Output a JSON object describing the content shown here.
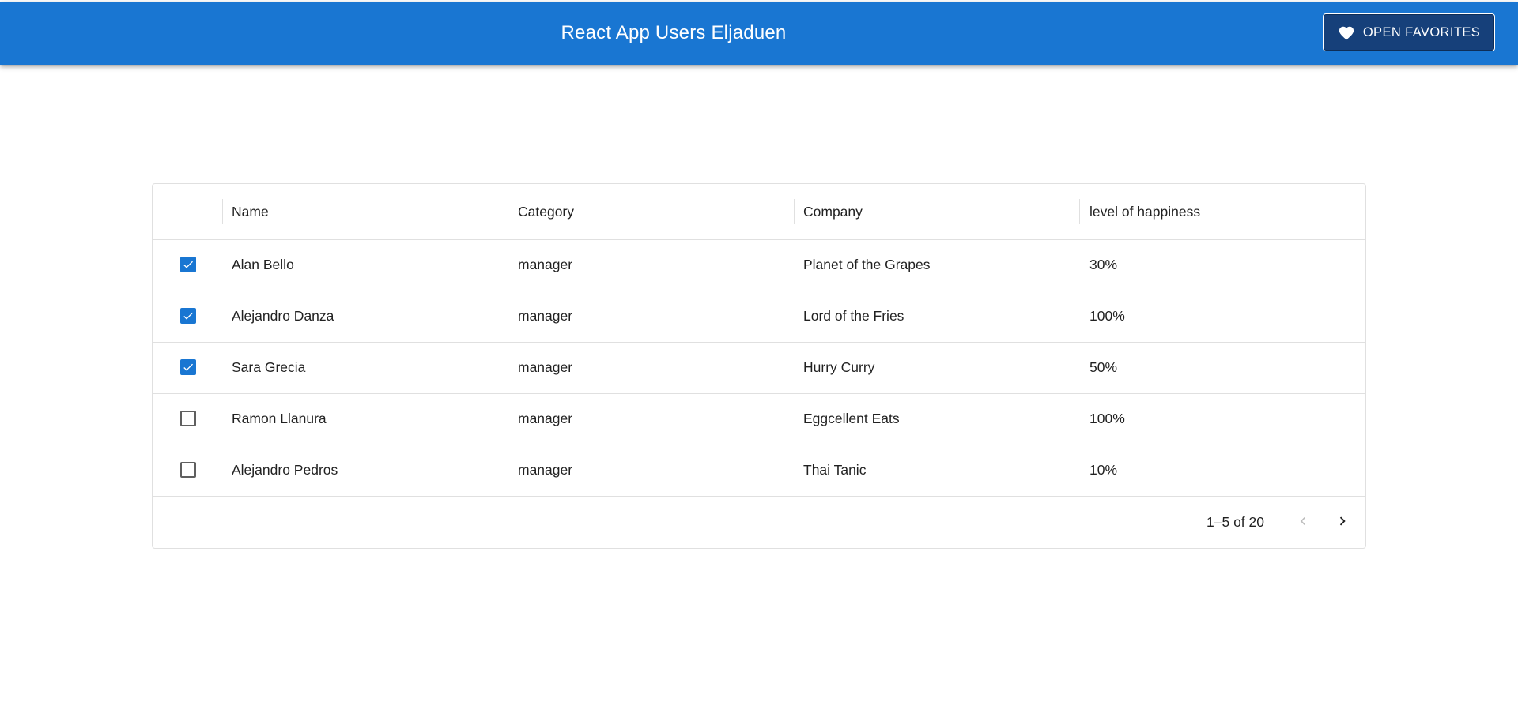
{
  "appbar": {
    "title": "React App Users Eljaduen",
    "favorites_button_label": "OPEN FAVORITES",
    "favorites_icon": "heart-icon",
    "background_color": "#1976d2"
  },
  "grid": {
    "columns": [
      "Name",
      "Category",
      "Company",
      "level of happiness"
    ],
    "rows": [
      {
        "checked": true,
        "name": "Alan Bello",
        "category": "manager",
        "company": "Planet of the Grapes",
        "happiness": "30%"
      },
      {
        "checked": true,
        "name": "Alejandro Danza",
        "category": "manager",
        "company": "Lord of the Fries",
        "happiness": "100%"
      },
      {
        "checked": true,
        "name": "Sara Grecia",
        "category": "manager",
        "company": "Hurry Curry",
        "happiness": "50%"
      },
      {
        "checked": false,
        "name": "Ramon Llanura",
        "category": "manager",
        "company": "Eggcellent Eats",
        "happiness": "100%"
      },
      {
        "checked": false,
        "name": "Alejandro Pedros",
        "category": "manager",
        "company": "Thai Tanic",
        "happiness": "10%"
      }
    ],
    "pagination": {
      "label": "1–5 of 20",
      "prev_icon": "chevron-left-icon",
      "next_icon": "chevron-right-icon",
      "prev_disabled": true
    },
    "checkbox_color": "#1976d2"
  }
}
